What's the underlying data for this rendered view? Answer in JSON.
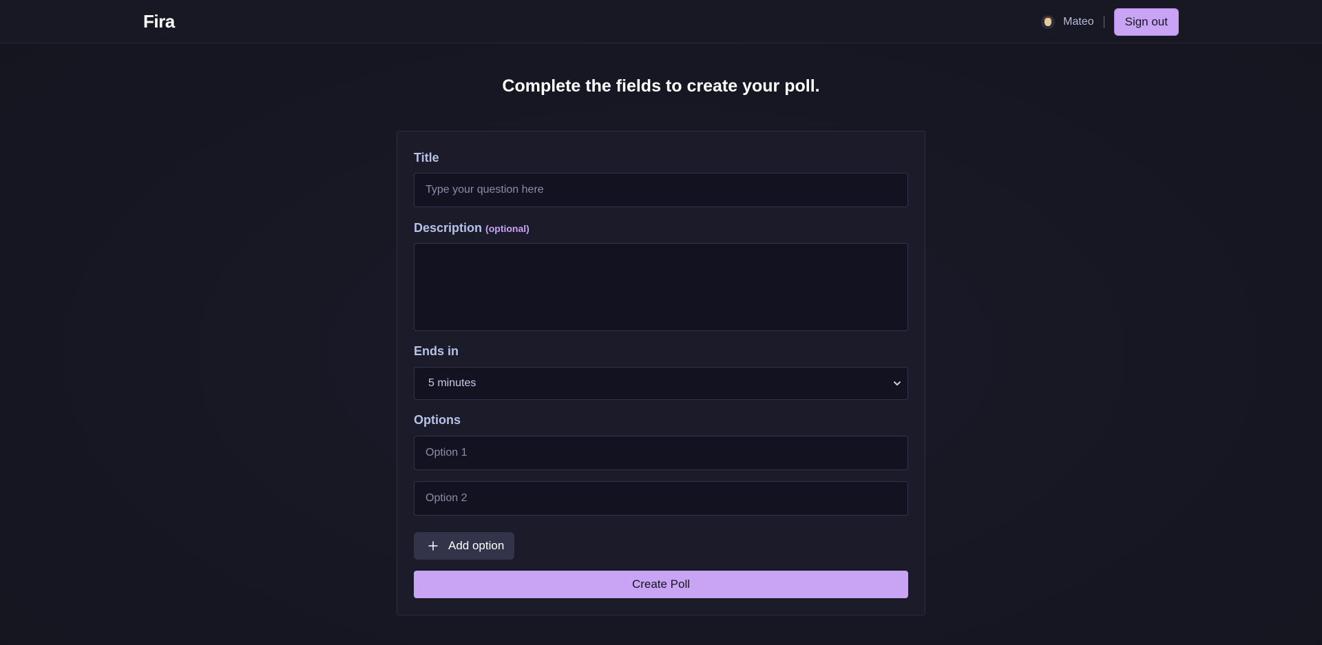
{
  "header": {
    "brand": "Fira",
    "user": {
      "name": "Mateo",
      "avatar": "avatar-icon"
    },
    "signout_label": "Sign out"
  },
  "main": {
    "heading": "Complete the fields to create your poll."
  },
  "form": {
    "title_label": "Title",
    "title_placeholder": "Type your question here",
    "description_label": "Description",
    "description_optional": "(optional)",
    "ends_label": "Ends in",
    "ends_value": "5 minutes",
    "options_label": "Options",
    "options": [
      {
        "placeholder": "Option 1"
      },
      {
        "placeholder": "Option 2"
      }
    ],
    "add_option_label": "Add option",
    "create_label": "Create Poll"
  },
  "colors": {
    "accent": "#c9a4f4",
    "background": "#181825",
    "card": "#1b1b29",
    "input": "#121220",
    "label": "#b6c2e8"
  },
  "icons": [
    "avatar-icon",
    "chevron-down-icon",
    "plus-icon"
  ]
}
